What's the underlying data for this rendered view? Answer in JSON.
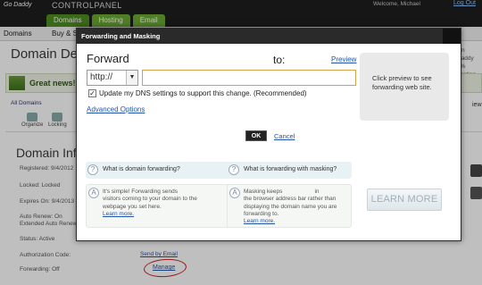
{
  "header": {
    "logo": "Go Daddy",
    "title": "CONTROLPANEL",
    "welcome": "Welcome, Michael",
    "logout": "Log Out",
    "tabs": [
      "Domains",
      "Hosting",
      "Email"
    ]
  },
  "menubar": {
    "domains": "Domains",
    "buy": "Buy & Se"
  },
  "page": {
    "title": "Domain Det",
    "promo_lines": [
      "ain",
      "Daddy",
      "0% hosting",
      "ts"
    ],
    "news": "Great news! Th",
    "all_domains": "All Domains",
    "tools": [
      "Organize",
      "Locking"
    ],
    "view": "iew",
    "panel_title": "Domain Inf",
    "info": {
      "registered": "Registered: 9/4/2012",
      "locked": "Locked: Locked",
      "expires": "Expires On: 9/4/2013",
      "auto_renew_1": "Auto Renew: On",
      "auto_renew_2": "Extended Auto Renew",
      "status": "Status: Active",
      "auth_code": "Authorization Code:",
      "forwarding": "Forwarding: Off"
    },
    "send_email": "Send by Email",
    "manage": "Manage"
  },
  "modal": {
    "title": "Forwarding and Masking",
    "forward_label": "Forward",
    "to_label": "to:",
    "preview_link": "Preview",
    "protocol": "http://",
    "url_value": "",
    "dns_checkbox_checked": true,
    "dns_label": "Update my DNS settings to support this change. (Recommended)",
    "advanced_options": "Advanced Options",
    "preview_text": "Click preview to see forwarding web site.",
    "ok": "OK",
    "cancel": "Cancel",
    "faq": [
      {
        "question": "What is domain forwarding?",
        "answer_lines": [
          "It's simple! Forwarding sends",
          "visitors coming to your domain to the",
          "webpage you set here."
        ],
        "link": "Learn more."
      },
      {
        "question": "What is forwarding with masking?",
        "answer_lines": [
          "Masking keeps                    in",
          "the browser address bar rather than",
          "displaying the domain name you are",
          "forwarding to."
        ],
        "link": "Learn more."
      }
    ],
    "learn_more": "LEARN MORE",
    "icons": {
      "question": "?",
      "answer": "A"
    }
  }
}
